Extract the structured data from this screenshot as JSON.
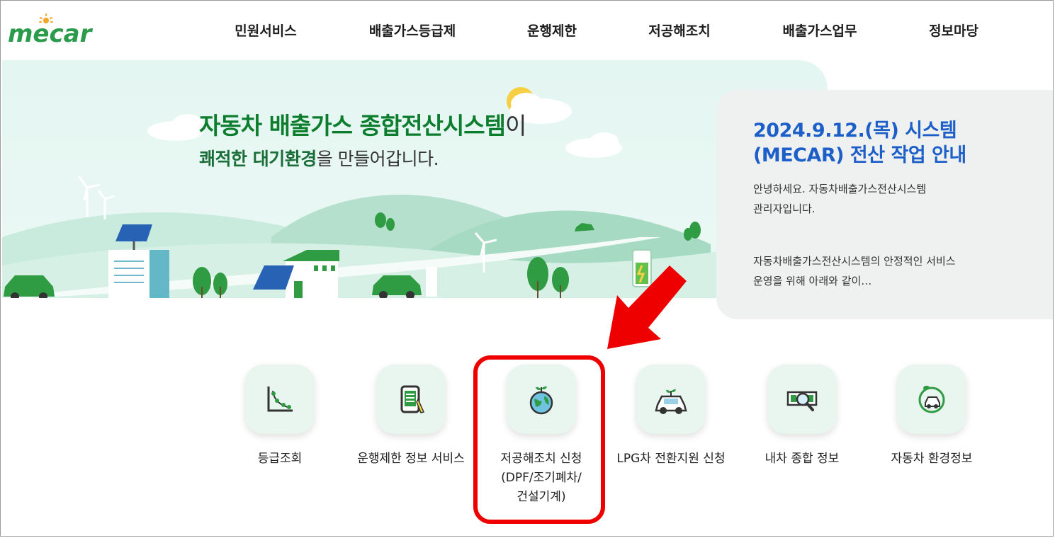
{
  "header": {
    "logo_text": "mecar",
    "nav": [
      "민원서비스",
      "배출가스등급제",
      "운행제한",
      "저공해조치",
      "배출가스업무",
      "정보마당"
    ]
  },
  "hero": {
    "title_accent": "자동차 배출가스 종합전산시스템",
    "title_tail": "이",
    "sub_accent": "쾌적한 대기환경",
    "sub_tail": "을 만들어갑니다."
  },
  "notice": {
    "title_line1": "2024.9.12.(목) 시스템",
    "title_line2": "(MECAR) 전산 작업 안내",
    "para1_line1": "안녕하세요. 자동차배출가스전산시스템",
    "para1_line2": "관리자입니다.",
    "para2_line1": "자동차배출가스전산시스템의 안정적인 서비스",
    "para2_line2": "운영을 위해 아래와 같이…"
  },
  "quick_menu": [
    {
      "icon": "grade-chart-icon",
      "label": "등급조회"
    },
    {
      "icon": "tablet-info-icon",
      "label": "운행제한 정보 서비스"
    },
    {
      "icon": "globe-sprout-icon",
      "label_line1": "저공해조치 신청",
      "label_line2": "(DPF/조기폐차/",
      "label_line3": "건설기계)"
    },
    {
      "icon": "eco-car-icon",
      "label": "LPG차 전환지원 신청"
    },
    {
      "icon": "money-search-icon",
      "label": "내차 종합 정보"
    },
    {
      "icon": "leaf-car-icon",
      "label": "자동차 환경정보"
    }
  ],
  "colors": {
    "brand_green": "#0c7d2d",
    "notice_blue": "#1d5fc8",
    "highlight_red": "#ee0000"
  }
}
